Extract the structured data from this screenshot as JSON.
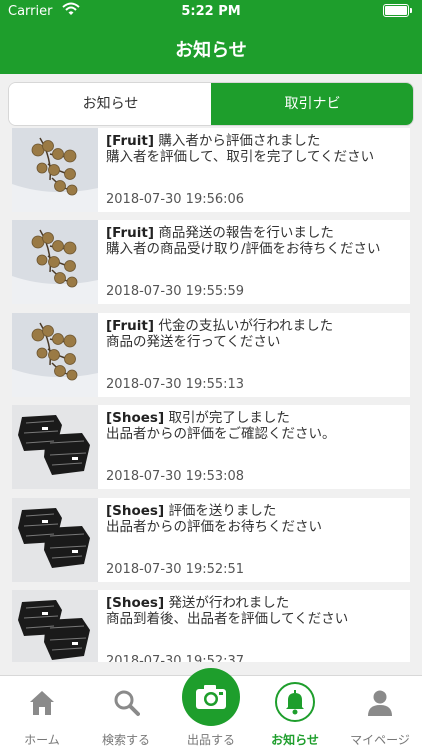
{
  "status_bar": {
    "carrier": "Carrier",
    "time": "5:22 PM"
  },
  "header": {
    "title": "お知らせ"
  },
  "segment": {
    "tabs": [
      "お知らせ",
      "取引ナビ"
    ],
    "selected": "取引ナビ",
    "accent": "#1e9e2c"
  },
  "notifications": [
    {
      "category": "[Fruit]",
      "title": "購入者から評価されました",
      "body": "購入者を評価して、取引を完了してください",
      "date": "2018-07-30 19:56:06",
      "thumbnail": "fruit"
    },
    {
      "category": "[Fruit]",
      "title": "商品発送の報告を行いました",
      "body": "購入者の商品受け取り/評価をお待ちください",
      "date": "2018-07-30 19:55:59",
      "thumbnail": "fruit"
    },
    {
      "category": "[Fruit]",
      "title": "代金の支払いが行われました",
      "body": "商品の発送を行ってください",
      "date": "2018-07-30 19:55:13",
      "thumbnail": "fruit"
    },
    {
      "category": "[Shoes]",
      "title": "取引が完了しました",
      "body": "出品者からの評価をご確認ください。",
      "date": "2018-07-30 19:53:08",
      "thumbnail": "shoes"
    },
    {
      "category": "[Shoes]",
      "title": "評価を送りました",
      "body": "出品者からの評価をお待ちください",
      "date": "2018-07-30 19:52:51",
      "thumbnail": "shoes"
    },
    {
      "category": "[Shoes]",
      "title": "発送が行われました",
      "body": "商品到着後、出品者を評価してください",
      "date": "2018-07-30 19:52:37",
      "thumbnail": "shoes"
    }
  ],
  "tabbar": {
    "items": [
      {
        "label": "ホーム",
        "icon": "home-icon"
      },
      {
        "label": "検索する",
        "icon": "search-icon"
      },
      {
        "label": "出品する",
        "icon": "camera-icon"
      },
      {
        "label": "お知らせ",
        "icon": "bell-icon"
      },
      {
        "label": "マイページ",
        "icon": "person-icon"
      }
    ],
    "active": "お知らせ"
  }
}
